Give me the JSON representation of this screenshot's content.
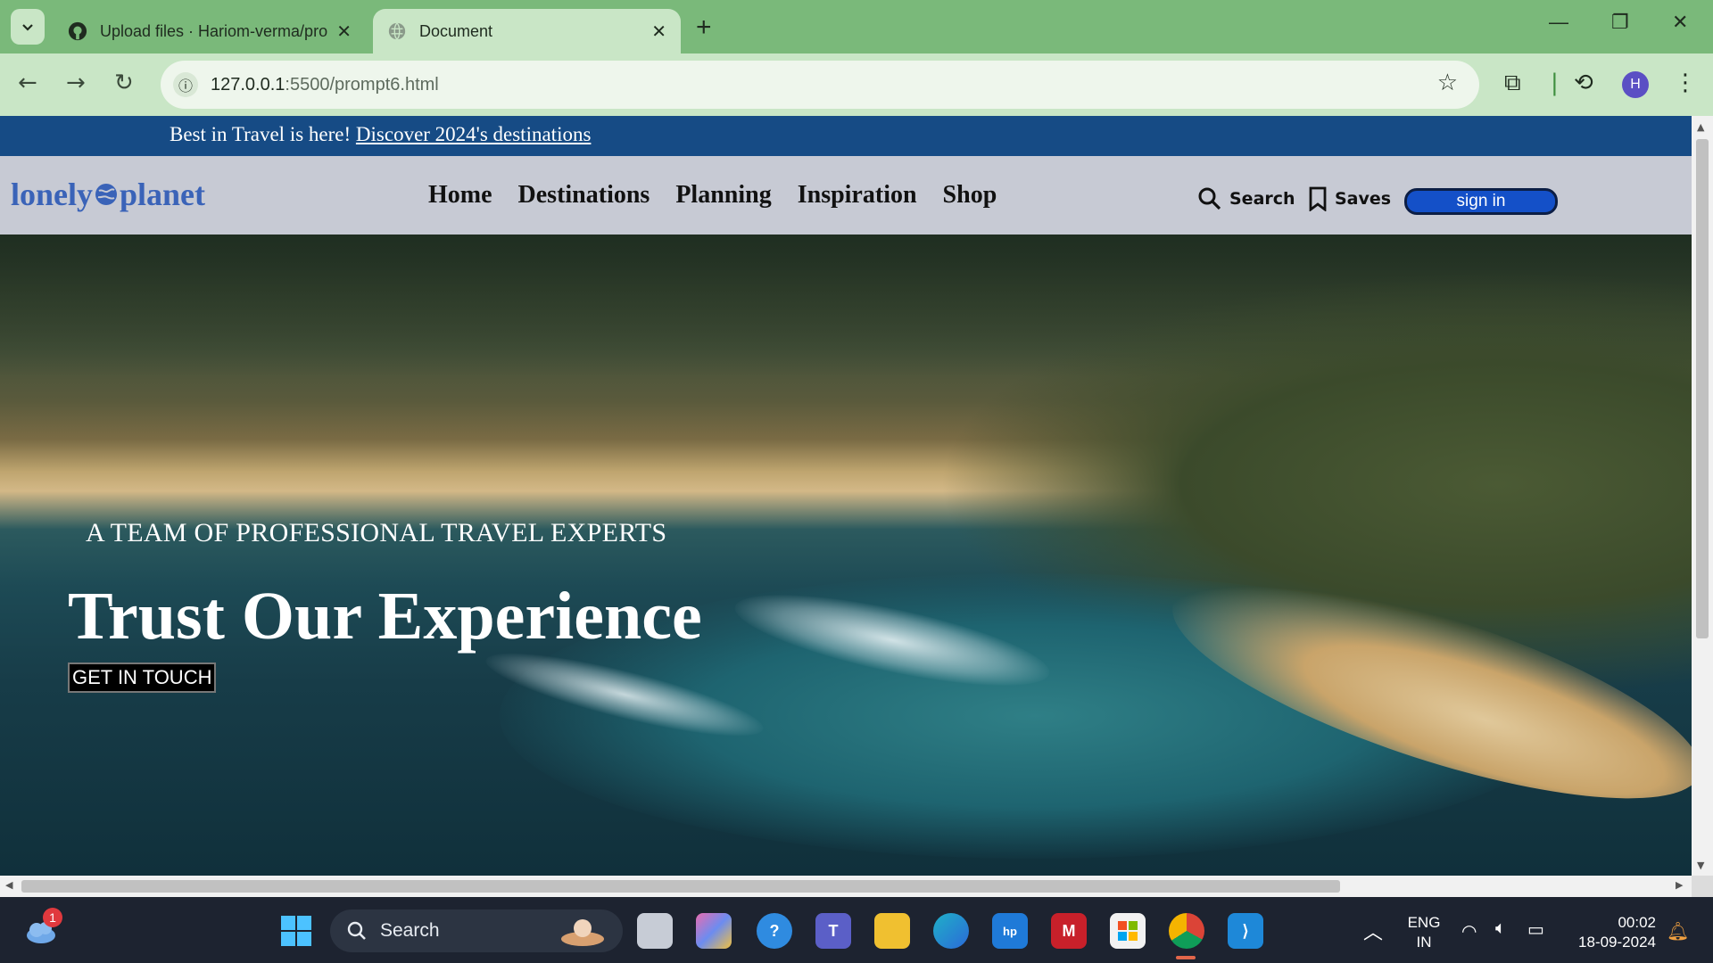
{
  "browser": {
    "tabs": [
      {
        "title": "Upload files · Hariom-verma/prompt",
        "active": false
      },
      {
        "title": "Document",
        "active": true
      }
    ],
    "url_host": "127.0.0.1",
    "url_rest": ":5500/prompt6.html",
    "profile_initial": "H"
  },
  "page": {
    "promo": {
      "text": "Best in Travel is here! ",
      "link": "Discover 2024's destinations"
    },
    "logo": {
      "part1": "lonely",
      "part2": "planet",
      "color": "#3a63b8"
    },
    "nav": [
      "Home",
      "Destinations",
      "Planning",
      "Inspiration",
      "Shop"
    ],
    "search_label": "Search",
    "saves_label": "Saves",
    "signin_label": "sign in",
    "hero": {
      "kicker": "A TEAM OF PROFESSIONAL TRAVEL EXPERTS",
      "title": "Trust Our Experience",
      "cta": "GET IN TOUCH"
    },
    "colors": {
      "promo_bg": "#164b85",
      "header_bg": "#c7cad4",
      "signin_bg": "#1450c8"
    }
  },
  "taskbar": {
    "search_placeholder": "Search",
    "weather_badge": "1",
    "lang_line1": "ENG",
    "lang_line2": "IN",
    "time": "00:02",
    "date": "18-09-2024"
  }
}
